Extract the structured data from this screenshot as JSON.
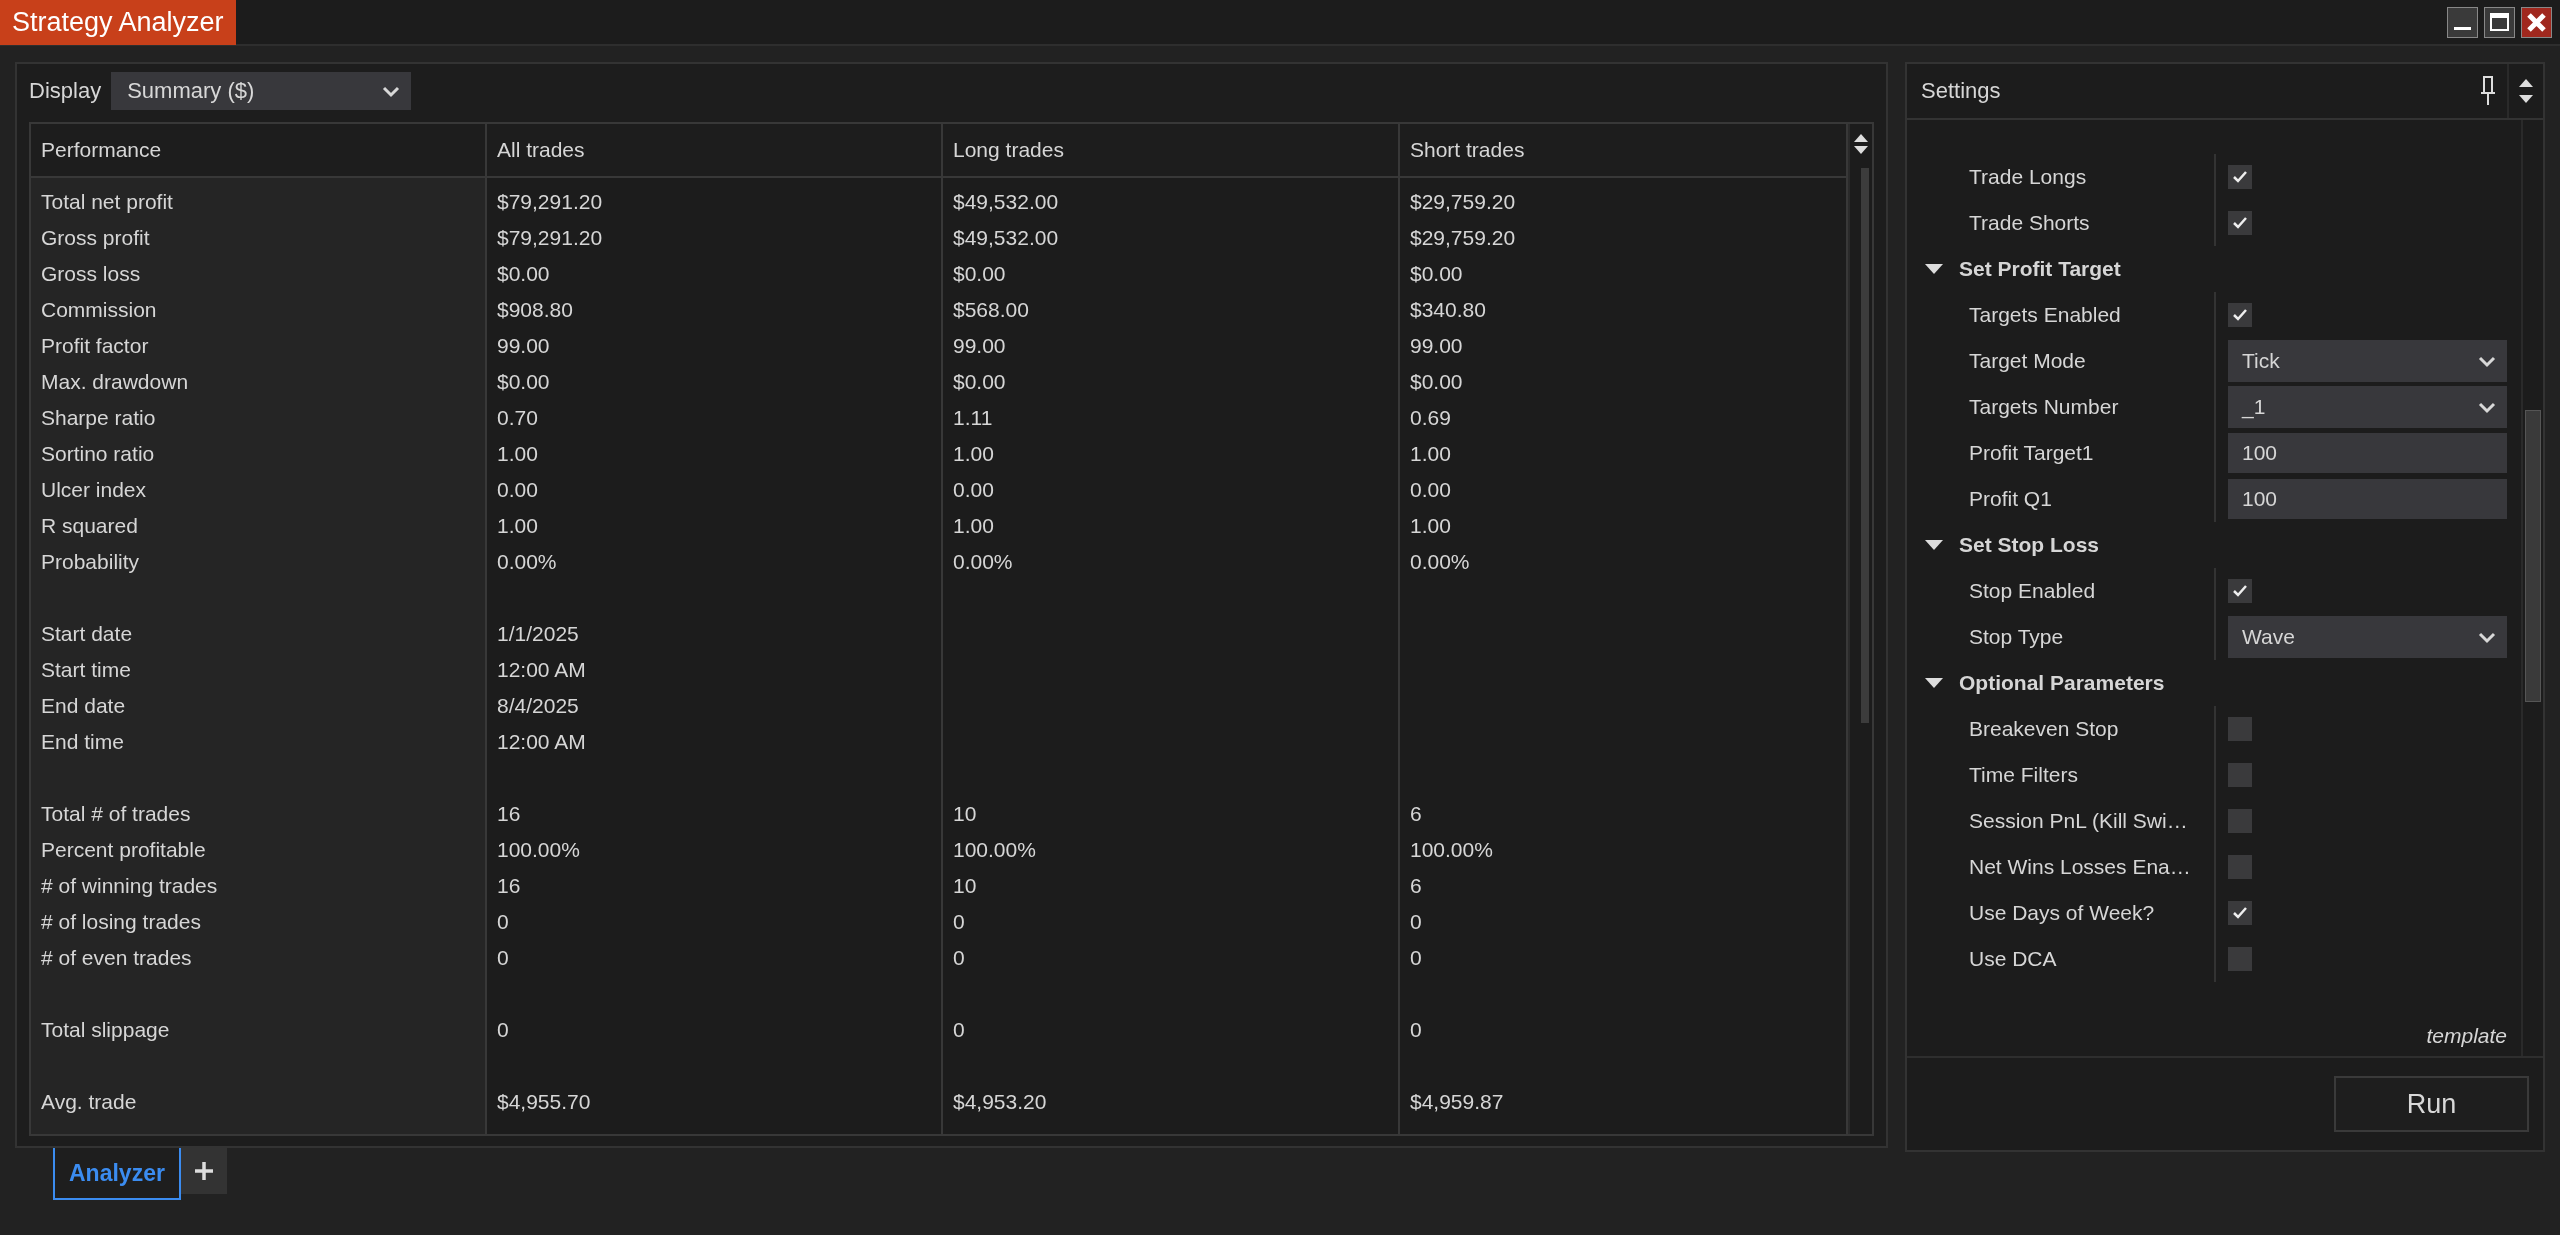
{
  "window": {
    "title": "Strategy Analyzer"
  },
  "display": {
    "label": "Display",
    "value": "Summary ($)"
  },
  "table": {
    "columns": [
      "Performance",
      "All trades",
      "Long trades",
      "Short trades"
    ],
    "row_groups": [
      [
        {
          "label": "Total net profit",
          "values": [
            "$79,291.20",
            "$49,532.00",
            "$29,759.20"
          ]
        },
        {
          "label": "Gross profit",
          "values": [
            "$79,291.20",
            "$49,532.00",
            "$29,759.20"
          ]
        },
        {
          "label": "Gross loss",
          "values": [
            "$0.00",
            "$0.00",
            "$0.00"
          ]
        },
        {
          "label": "Commission",
          "values": [
            "$908.80",
            "$568.00",
            "$340.80"
          ]
        },
        {
          "label": "Profit factor",
          "values": [
            "99.00",
            "99.00",
            "99.00"
          ]
        },
        {
          "label": "Max. drawdown",
          "values": [
            "$0.00",
            "$0.00",
            "$0.00"
          ]
        },
        {
          "label": "Sharpe ratio",
          "values": [
            "0.70",
            "1.11",
            "0.69"
          ]
        },
        {
          "label": "Sortino ratio",
          "values": [
            "1.00",
            "1.00",
            "1.00"
          ]
        },
        {
          "label": "Ulcer index",
          "values": [
            "0.00",
            "0.00",
            "0.00"
          ]
        },
        {
          "label": "R squared",
          "values": [
            "1.00",
            "1.00",
            "1.00"
          ]
        },
        {
          "label": "Probability",
          "values": [
            "0.00%",
            "0.00%",
            "0.00%"
          ]
        }
      ],
      [
        {
          "label": "Start date",
          "values": [
            "1/1/2025"
          ]
        },
        {
          "label": "Start time",
          "values": [
            "12:00 AM"
          ]
        },
        {
          "label": "End date",
          "values": [
            "8/4/2025"
          ]
        },
        {
          "label": "End time",
          "values": [
            "12:00 AM"
          ]
        }
      ],
      [
        {
          "label": "Total # of trades",
          "values": [
            "16",
            "10",
            "6"
          ]
        },
        {
          "label": "Percent profitable",
          "values": [
            "100.00%",
            "100.00%",
            "100.00%"
          ]
        },
        {
          "label": "# of winning trades",
          "values": [
            "16",
            "10",
            "6"
          ]
        },
        {
          "label": "# of losing trades",
          "values": [
            "0",
            "0",
            "0"
          ]
        },
        {
          "label": "# of even trades",
          "values": [
            "0",
            "0",
            "0"
          ]
        }
      ],
      [
        {
          "label": "Total slippage",
          "values": [
            "0",
            "0",
            "0"
          ]
        }
      ],
      [
        {
          "label": "Avg. trade",
          "values": [
            "$4,955.70",
            "$4,953.20",
            "$4,959.87"
          ]
        }
      ]
    ]
  },
  "settings": {
    "title": "Settings",
    "items": [
      {
        "kind": "checkbox",
        "label": "Trade Longs",
        "checked": true
      },
      {
        "kind": "checkbox",
        "label": "Trade Shorts",
        "checked": true
      },
      {
        "kind": "category",
        "label": "Set Profit Target",
        "expanded": true,
        "children": [
          {
            "kind": "checkbox",
            "label": "Targets Enabled",
            "checked": true
          },
          {
            "kind": "dropdown",
            "label": "Target Mode",
            "value": "Tick"
          },
          {
            "kind": "dropdown",
            "label": "Targets Number",
            "value": "_1"
          },
          {
            "kind": "number",
            "label": "Profit Target1",
            "value": "100"
          },
          {
            "kind": "number",
            "label": "Profit Q1",
            "value": "100"
          }
        ]
      },
      {
        "kind": "category",
        "label": "Set Stop Loss",
        "expanded": true,
        "children": [
          {
            "kind": "checkbox",
            "label": "Stop Enabled",
            "checked": true
          },
          {
            "kind": "dropdown",
            "label": "Stop Type",
            "value": "Wave"
          }
        ]
      },
      {
        "kind": "category",
        "label": "Optional Parameters",
        "expanded": true,
        "children": [
          {
            "kind": "checkbox",
            "label": "Breakeven Stop",
            "checked": false
          },
          {
            "kind": "checkbox",
            "label": "Time Filters",
            "checked": false
          },
          {
            "kind": "checkbox",
            "label": "Session PnL (Kill Swi…",
            "checked": false
          },
          {
            "kind": "checkbox",
            "label": "Net Wins Losses Ena…",
            "checked": false
          },
          {
            "kind": "checkbox",
            "label": "Use Days of Week?",
            "checked": true
          },
          {
            "kind": "checkbox",
            "label": "Use DCA",
            "checked": false
          }
        ]
      }
    ],
    "template_label": "template",
    "run_button": "Run"
  },
  "tabs": [
    {
      "label": "Analyzer",
      "selected": true
    }
  ]
}
